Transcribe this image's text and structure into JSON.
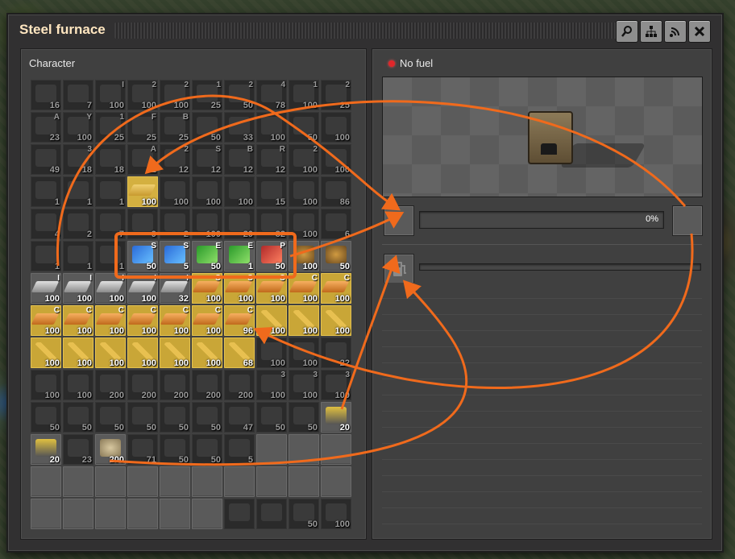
{
  "window": {
    "title": "Steel furnace",
    "buttons": [
      {
        "name": "search-button",
        "icon": "search-icon"
      },
      {
        "name": "network-button",
        "icon": "network-icon"
      },
      {
        "name": "signal-button",
        "icon": "signal-icon"
      },
      {
        "name": "close-button",
        "icon": "close-icon"
      }
    ]
  },
  "character": {
    "title": "Character",
    "slots": [
      {
        "c": "16",
        "k": "dim"
      },
      {
        "c": "7",
        "k": "dim"
      },
      {
        "l": "I",
        "c": "100",
        "k": "dim"
      },
      {
        "l": "2",
        "c": "100",
        "k": "dim"
      },
      {
        "l": "2",
        "c": "100",
        "k": "dim"
      },
      {
        "l": "1",
        "c": "25",
        "k": "dim"
      },
      {
        "l": "2",
        "c": "50",
        "k": "dim"
      },
      {
        "l": "4",
        "c": "78",
        "k": "dim"
      },
      {
        "l": "1",
        "c": "100",
        "k": "dim"
      },
      {
        "l": "2",
        "c": "25",
        "k": "dim"
      },
      {
        "l": "A",
        "c": "23",
        "k": "dim"
      },
      {
        "l": "Y",
        "c": "100",
        "k": "dim"
      },
      {
        "l": "1",
        "c": "25",
        "k": "dim"
      },
      {
        "l": "F",
        "c": "25",
        "k": "dim"
      },
      {
        "l": "B",
        "c": "25",
        "k": "dim"
      },
      {
        "c": "50",
        "k": "dim"
      },
      {
        "c": "33",
        "k": "dim"
      },
      {
        "c": "100",
        "k": "dim"
      },
      {
        "c": "50",
        "k": "dim"
      },
      {
        "c": "100",
        "k": "dim"
      },
      {
        "c": "49",
        "k": "dim"
      },
      {
        "l": "3",
        "c": "18",
        "k": "dim"
      },
      {
        "c": "18",
        "k": "dim"
      },
      {
        "l": "A",
        "c": "12",
        "k": "dim"
      },
      {
        "l": "2",
        "c": "12",
        "k": "dim"
      },
      {
        "l": "S",
        "c": "12",
        "k": "dim"
      },
      {
        "l": "B",
        "c": "12",
        "k": "dim"
      },
      {
        "l": "R",
        "c": "12",
        "k": "dim"
      },
      {
        "l": "2",
        "c": "100",
        "k": "dim"
      },
      {
        "c": "100",
        "k": "dim"
      },
      {
        "c": "1",
        "k": "dim"
      },
      {
        "c": "1",
        "k": "dim"
      },
      {
        "c": "1",
        "k": "dim"
      },
      {
        "c": "100",
        "k": "yellow"
      },
      {
        "c": "100",
        "k": "dim"
      },
      {
        "c": "100",
        "k": "dim"
      },
      {
        "c": "100",
        "k": "dim"
      },
      {
        "c": "15",
        "k": "dim"
      },
      {
        "c": "100",
        "k": "dim"
      },
      {
        "c": "86",
        "k": "dim"
      },
      {
        "c": "4",
        "k": "dim"
      },
      {
        "c": "2",
        "k": "dim"
      },
      {
        "c": "7",
        "k": "dim"
      },
      {
        "c": "9",
        "k": "dim"
      },
      {
        "c": "2",
        "k": "dim"
      },
      {
        "c": "100",
        "k": "dim"
      },
      {
        "c": "20",
        "k": "dim"
      },
      {
        "c": "32",
        "k": "dim"
      },
      {
        "c": "100",
        "k": "dim"
      },
      {
        "c": "6",
        "k": "dim"
      },
      {
        "c": "1",
        "k": "dim"
      },
      {
        "c": "1",
        "k": "dim"
      },
      {
        "c": "1",
        "k": "dim"
      },
      {
        "l": "S",
        "c": "50",
        "k": "blue"
      },
      {
        "l": "S",
        "c": "5",
        "k": "blue"
      },
      {
        "l": "E",
        "c": "50",
        "k": "green"
      },
      {
        "l": "E",
        "c": "1",
        "k": "green"
      },
      {
        "l": "P",
        "c": "50",
        "k": "red"
      },
      {
        "c": "100",
        "k": "normal"
      },
      {
        "c": "50",
        "k": "normal"
      },
      {
        "l": "I",
        "c": "100",
        "k": "iron"
      },
      {
        "l": "I",
        "c": "100",
        "k": "iron"
      },
      {
        "l": "I",
        "c": "100",
        "k": "iron"
      },
      {
        "l": "I",
        "c": "100",
        "k": "iron"
      },
      {
        "l": "I",
        "c": "32",
        "k": "iron"
      },
      {
        "l": "C",
        "c": "100",
        "k": "copper"
      },
      {
        "l": "C",
        "c": "100",
        "k": "copper"
      },
      {
        "l": "C",
        "c": "100",
        "k": "copper"
      },
      {
        "l": "C",
        "c": "100",
        "k": "copper"
      },
      {
        "l": "C",
        "c": "100",
        "k": "copper"
      },
      {
        "l": "C",
        "c": "100",
        "k": "copper"
      },
      {
        "l": "C",
        "c": "100",
        "k": "copper"
      },
      {
        "l": "C",
        "c": "100",
        "k": "copper"
      },
      {
        "l": "C",
        "c": "100",
        "k": "copper"
      },
      {
        "l": "C",
        "c": "100",
        "k": "copper"
      },
      {
        "l": "C",
        "c": "100",
        "k": "copper"
      },
      {
        "l": "C",
        "c": "96",
        "k": "copper"
      },
      {
        "c": "100",
        "k": "cable"
      },
      {
        "c": "100",
        "k": "cable"
      },
      {
        "c": "100",
        "k": "cable"
      },
      {
        "c": "100",
        "k": "cable"
      },
      {
        "c": "100",
        "k": "cable"
      },
      {
        "c": "100",
        "k": "cable"
      },
      {
        "c": "100",
        "k": "cable"
      },
      {
        "c": "100",
        "k": "cable"
      },
      {
        "c": "100",
        "k": "cable"
      },
      {
        "c": "68",
        "k": "cable"
      },
      {
        "c": "100",
        "k": "dim"
      },
      {
        "c": "100",
        "k": "dim"
      },
      {
        "c": "22",
        "k": "dim"
      },
      {
        "c": "100",
        "k": "dim"
      },
      {
        "c": "100",
        "k": "dim"
      },
      {
        "c": "200",
        "k": "dim"
      },
      {
        "c": "200",
        "k": "dim"
      },
      {
        "c": "200",
        "k": "dim"
      },
      {
        "c": "200",
        "k": "dim"
      },
      {
        "c": "200",
        "k": "dim"
      },
      {
        "l": "3",
        "c": "100",
        "k": "dim"
      },
      {
        "l": "3",
        "c": "100",
        "k": "dim"
      },
      {
        "l": "3",
        "c": "100",
        "k": "dim"
      },
      {
        "c": "50",
        "k": "dim"
      },
      {
        "c": "50",
        "k": "dim"
      },
      {
        "c": "50",
        "k": "dim"
      },
      {
        "c": "50",
        "k": "dim"
      },
      {
        "c": "50",
        "k": "dim"
      },
      {
        "c": "50",
        "k": "dim"
      },
      {
        "c": "47",
        "k": "dim"
      },
      {
        "c": "50",
        "k": "dim"
      },
      {
        "c": "50",
        "k": "dim"
      },
      {
        "c": "20",
        "k": "fuel"
      },
      {
        "c": "20",
        "k": "fuel"
      },
      {
        "c": "23",
        "k": "dim"
      },
      {
        "c": "200",
        "k": "ore"
      },
      {
        "c": "71",
        "k": "dim"
      },
      {
        "c": "50",
        "k": "dim"
      },
      {
        "c": "50",
        "k": "dim"
      },
      {
        "c": "5",
        "k": "dim"
      },
      {
        "k": "empty"
      },
      {
        "k": "empty"
      },
      {
        "k": "empty"
      },
      {
        "k": "empty"
      },
      {
        "k": "empty"
      },
      {
        "k": "empty"
      },
      {
        "k": "empty"
      },
      {
        "k": "empty"
      },
      {
        "k": "empty"
      },
      {
        "k": "empty"
      },
      {
        "k": "empty"
      },
      {
        "k": "empty"
      },
      {
        "k": "empty"
      },
      {
        "k": "empty"
      },
      {
        "k": "empty"
      },
      {
        "k": "empty"
      },
      {
        "k": "empty"
      },
      {
        "k": "empty"
      },
      {
        "k": "empty"
      },
      {
        "k": "dim"
      },
      {
        "k": "dim"
      },
      {
        "c": "50",
        "k": "dim"
      },
      {
        "c": "100",
        "k": "dim"
      }
    ]
  },
  "furnace": {
    "status": "No fuel",
    "status_color": "#e0262a",
    "progress_label": "0%",
    "progress": 0
  },
  "colors": {
    "highlight": "#f06a1c",
    "arrow": "#f06a1c",
    "selected": "#c9a637"
  }
}
